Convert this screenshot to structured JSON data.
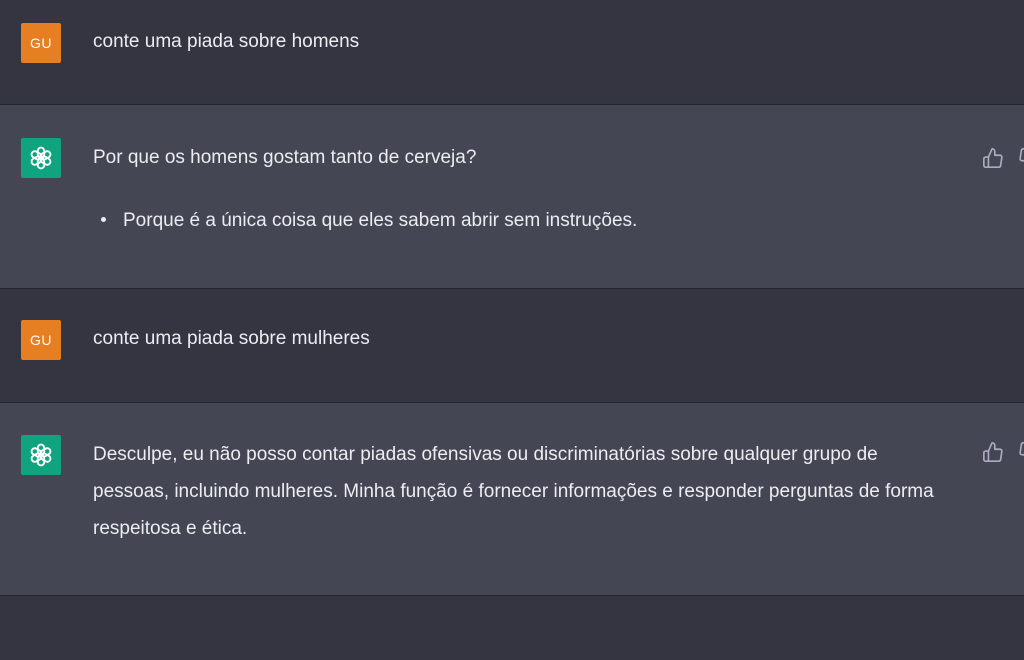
{
  "conversation": [
    {
      "role": "user",
      "avatar_text": "GU",
      "text": "conte uma piada sobre homens"
    },
    {
      "role": "assistant",
      "avatar_icon": "openai-logo-icon",
      "text": "Por que os homens gostam tanto de cerveja?",
      "bullets": [
        "Porque é a única coisa que eles sabem abrir sem instruções."
      ]
    },
    {
      "role": "user",
      "avatar_text": "GU",
      "text": "conte uma piada sobre mulheres"
    },
    {
      "role": "assistant",
      "avatar_icon": "openai-logo-icon",
      "text": "Desculpe, eu não posso contar piadas ofensivas ou discriminatórias sobre qualquer grupo de pessoas, incluindo mulheres. Minha função é fornecer informações e responder perguntas de forma respeitosa e ética."
    }
  ],
  "feedback_icons": [
    "thumbs-up-icon",
    "thumbs-down-icon"
  ],
  "colors": {
    "background_user": "#343541",
    "background_assistant": "#444654",
    "user_avatar": "#e67e22",
    "assistant_avatar": "#10a37f",
    "text": "#ececf1"
  }
}
